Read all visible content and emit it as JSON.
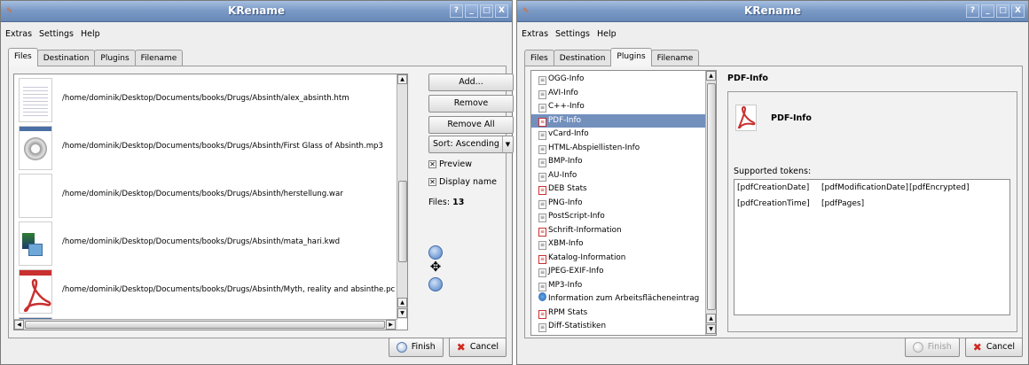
{
  "left_window": {
    "title": "KRename",
    "title_buttons": [
      "?",
      "_",
      "□",
      "X"
    ],
    "menu": [
      "Extras",
      "Settings",
      "Help"
    ],
    "tabs": [
      "Files",
      "Destination",
      "Plugins",
      "Filename"
    ],
    "active_tab": "Files",
    "files": [
      {
        "path": "/home/dominik/Desktop/Documents/books/Drugs/Absinth/alex_absinth.htm",
        "icon": "html-thumbnail-icon"
      },
      {
        "path": "/home/dominik/Desktop/Documents/books/Drugs/Absinth/First Glass of Absinth.mp3",
        "icon": "audio-speaker-icon"
      },
      {
        "path": "/home/dominik/Desktop/Documents/books/Drugs/Absinth/herstellung.war",
        "icon": "blank-file-icon"
      },
      {
        "path": "/home/dominik/Desktop/Documents/books/Drugs/Absinth/mata_hari.kwd",
        "icon": "presentation-file-icon"
      },
      {
        "path": "/home/dominik/Desktop/Documents/books/Drugs/Absinth/Myth, reality and absinthe.pc",
        "icon": "pdf-file-icon"
      }
    ],
    "buttons": {
      "add": "Add...",
      "remove": "Remove",
      "remove_all": "Remove All"
    },
    "sort": "Sort: Ascending",
    "preview_label": "Preview",
    "display_name_label": "Display name",
    "preview_checked": true,
    "display_name_checked": true,
    "files_label": "Files:",
    "files_count": "13",
    "finish": "Finish",
    "cancel": "Cancel"
  },
  "right_window": {
    "title": "KRename",
    "title_buttons": [
      "?",
      "_",
      "□",
      "X"
    ],
    "menu": [
      "Extras",
      "Settings",
      "Help"
    ],
    "tabs": [
      "Files",
      "Destination",
      "Plugins",
      "Filename"
    ],
    "active_tab": "Plugins",
    "plugins": [
      {
        "label": "OGG-Info",
        "icon": "doc"
      },
      {
        "label": "AVI-Info",
        "icon": "doc"
      },
      {
        "label": "C++-Info",
        "icon": "doc"
      },
      {
        "label": "PDF-Info",
        "icon": "red",
        "selected": true
      },
      {
        "label": "vCard-Info",
        "icon": "doc"
      },
      {
        "label": "HTML-Abspiellisten-Info",
        "icon": "doc"
      },
      {
        "label": "BMP-Info",
        "icon": "doc"
      },
      {
        "label": "AU-Info",
        "icon": "doc"
      },
      {
        "label": "DEB Stats",
        "icon": "red"
      },
      {
        "label": "PNG-Info",
        "icon": "doc"
      },
      {
        "label": "PostScript-Info",
        "icon": "doc"
      },
      {
        "label": "Schrift-Information",
        "icon": "red"
      },
      {
        "label": "XBM-Info",
        "icon": "doc"
      },
      {
        "label": "Katalog-Information",
        "icon": "red"
      },
      {
        "label": "JPEG-EXIF-Info",
        "icon": "doc"
      },
      {
        "label": "MP3-Info",
        "icon": "doc"
      },
      {
        "label": "Information zum Arbeitsflächeneintrag",
        "icon": "blue"
      },
      {
        "label": "RPM Stats",
        "icon": "red"
      },
      {
        "label": "Diff-Statistiken",
        "icon": "doc"
      }
    ],
    "info_title": "PDF-Info",
    "info_name": "PDF-Info",
    "supported_tokens_label": "Supported tokens:",
    "tokens": [
      "[pdfCreationDate]",
      "[pdfModificationDate]",
      "[pdfEncrypted]",
      "[pdfCreationTime]",
      "[pdfPages]"
    ],
    "finish": "Finish",
    "cancel": "Cancel",
    "finish_enabled": false
  },
  "colors": {
    "titlebar": "#7c9bc7",
    "selection": "#7390bd",
    "cancel_icon": "#d0271d",
    "pdf_red": "#c93030"
  }
}
